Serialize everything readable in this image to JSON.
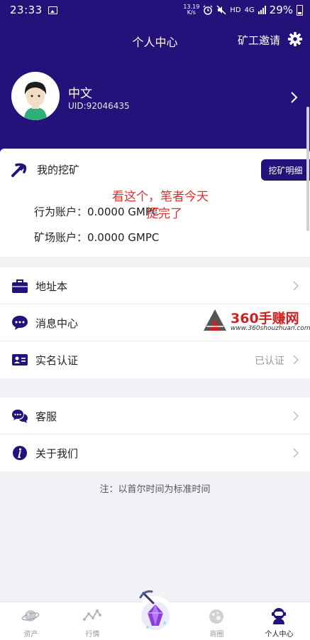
{
  "status_bar": {
    "time": "23:33",
    "speed_value": "13.19",
    "speed_unit": "K/s",
    "network": "HD",
    "network_gen": "4G",
    "battery": "29%"
  },
  "header": {
    "title": "个人中心",
    "invite_label": "矿工邀请"
  },
  "profile": {
    "name": "中文",
    "uid": "UID:92046435"
  },
  "mining": {
    "title": "我的挖矿",
    "detail_button": "挖矿明细",
    "behavior_account": "行为账户：0.0000 GMPC",
    "mine_account": "矿场账户：0.0000 GMPC"
  },
  "annotation": {
    "line1": "看这个，笔者今天",
    "line2": "提完了"
  },
  "menu_group_1": [
    {
      "label": "地址本",
      "value": "",
      "icon": "briefcase-icon"
    },
    {
      "label": "消息中心",
      "value": "",
      "icon": "message-icon"
    },
    {
      "label": "实名认证",
      "value": "已认证",
      "icon": "id-card-icon"
    }
  ],
  "menu_group_2": [
    {
      "label": "客服",
      "value": "",
      "icon": "chat-bubbles-icon"
    },
    {
      "label": "关于我们",
      "value": "",
      "icon": "info-icon"
    }
  ],
  "footnote": "注：以首尔时间为标准时间",
  "watermark": {
    "text": "360手赚网",
    "url": "www.360shouzhuan.com"
  },
  "bottom_nav": [
    {
      "label": "资产",
      "icon": "planet-icon"
    },
    {
      "label": "行情",
      "icon": "trend-line-icon"
    },
    {
      "label": "",
      "icon": "mining-crystal-icon"
    },
    {
      "label": "商圈",
      "icon": "shop-planet-icon"
    },
    {
      "label": "个人中心",
      "icon": "astronaut-icon",
      "active": true
    }
  ],
  "colors": {
    "brand": "#24127a",
    "annotation": "#d6322e",
    "watermark": "#d02020"
  }
}
